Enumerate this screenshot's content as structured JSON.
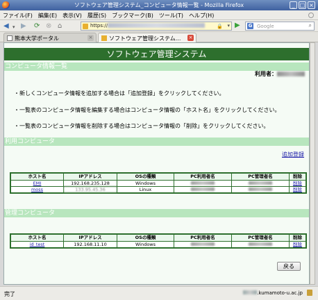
{
  "window": {
    "title": "ソフトウェア管理システム_コンピュータ情報一覧 - Mozilla Firefox",
    "controls": [
      "_",
      "□",
      "×"
    ]
  },
  "menu": [
    "ファイル(F)",
    "編集(E)",
    "表示(V)",
    "履歴(S)",
    "ブックマーク(B)",
    "ツール(T)",
    "ヘルプ(H)"
  ],
  "nav": {
    "url_prefix": "https://",
    "search_placeholder": "Google"
  },
  "tabs": [
    {
      "label": "熊本大学ポータル"
    },
    {
      "label": "ソフトウェア管理システム..."
    }
  ],
  "page": {
    "header": "ソフトウェア管理システム",
    "section_info": "コンピュータ情報一覧",
    "user_label": "利用者：",
    "instructions": [
      "・新しくコンピュータ情報を追加する場合は「追加登録」をクリックしてください。",
      "・一覧表のコンピュータ情報を編集する場合はコンピュータ情報の「ホスト名」をクリックしてください。",
      "・一覧表のコンピュータ情報を削除する場合はコンピュータ情報の「削除」をクリックしてください。"
    ],
    "section_use": "利用コンピュータ",
    "add_link": "追加登録",
    "section_admin": "管理コンピュータ",
    "back_button": "戻る"
  },
  "table_headers": [
    "ホスト名",
    "IPアドレス",
    "OSの種類",
    "PC利用者名",
    "PC管理者名",
    "削除"
  ],
  "use_computers": [
    {
      "host": "EMI",
      "ip": "192.168.235.128",
      "os": "Windows",
      "del": "削除"
    },
    {
      "host": "moss",
      "ip": "133.95.45.36",
      "os": "Linux",
      "del": "削除"
    }
  ],
  "admin_computers": [
    {
      "host": "id_test",
      "ip": "192.168.11.10",
      "os": "Windows",
      "del": "削除"
    }
  ],
  "status": {
    "text": "完了",
    "domain_suffix": ".kumamoto-u.ac.jp"
  }
}
